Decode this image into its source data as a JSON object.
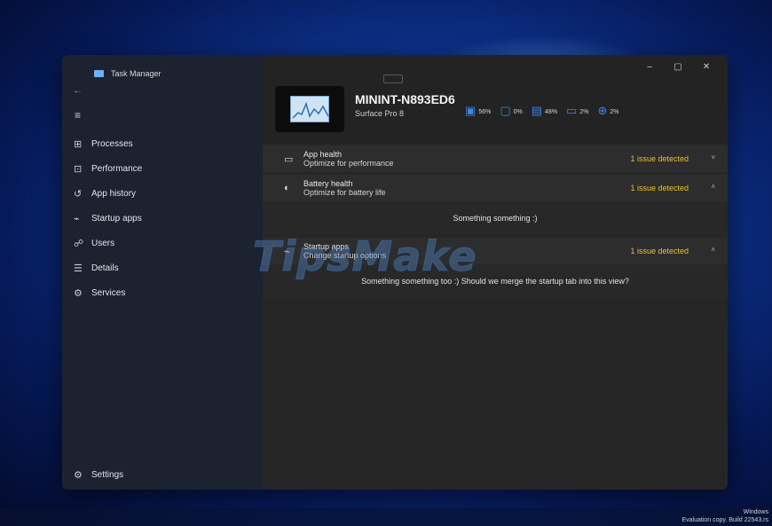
{
  "window": {
    "app_title": "Task Manager",
    "controls": {
      "minimize": "–",
      "maximize": "▢",
      "close": "✕"
    }
  },
  "sidebar": {
    "back_icon": "←",
    "menu_icon": "≡",
    "items": [
      {
        "label": "Processes",
        "icon": "⊞"
      },
      {
        "label": "Performance",
        "icon": "⊡"
      },
      {
        "label": "App history",
        "icon": "↺"
      },
      {
        "label": "Startup apps",
        "icon": "⌁"
      },
      {
        "label": "Users",
        "icon": "☍"
      },
      {
        "label": "Details",
        "icon": "☰"
      },
      {
        "label": "Services",
        "icon": "⚙"
      }
    ],
    "settings": {
      "label": "Settings",
      "icon": "⚙"
    }
  },
  "device": {
    "name": "MININT-N893ED6",
    "model": "Surface Pro 8",
    "metrics": [
      {
        "icon": "cpu-icon",
        "glyph": "▣",
        "value": "56%"
      },
      {
        "icon": "memory-icon",
        "glyph": "▢",
        "value": "0%"
      },
      {
        "icon": "disk-icon",
        "glyph": "▤",
        "value": "48%"
      },
      {
        "icon": "network-icon",
        "glyph": "▭",
        "value": "2%"
      },
      {
        "icon": "globe-icon",
        "glyph": "⊕",
        "value": "2%"
      }
    ]
  },
  "sections": {
    "app_health": {
      "title": "App health",
      "subtitle": "Optimize for performance",
      "issue": "1 issue detected",
      "chevron": "˅"
    },
    "battery_health": {
      "title": "Battery health",
      "subtitle": "Optimize for battery life",
      "issue": "1 issue detected",
      "chevron": "˄",
      "body": "Something something :)"
    },
    "startup_apps": {
      "title": "Startup apps",
      "subtitle": "Change startup options",
      "issue": "1 issue detected",
      "chevron": "˄",
      "body": "Something something too :) Should we merge the startup tab into this view?"
    }
  },
  "overlay": {
    "logo": "TipsMake",
    "desktop_watermark_line1": "Windows",
    "desktop_watermark_line2": "Evaluation copy. Build 22543.rs"
  },
  "colors": {
    "issue": "#e8c22c",
    "accent": "#3d86e0",
    "sidebar": "#1c2230",
    "main": "#262626"
  }
}
